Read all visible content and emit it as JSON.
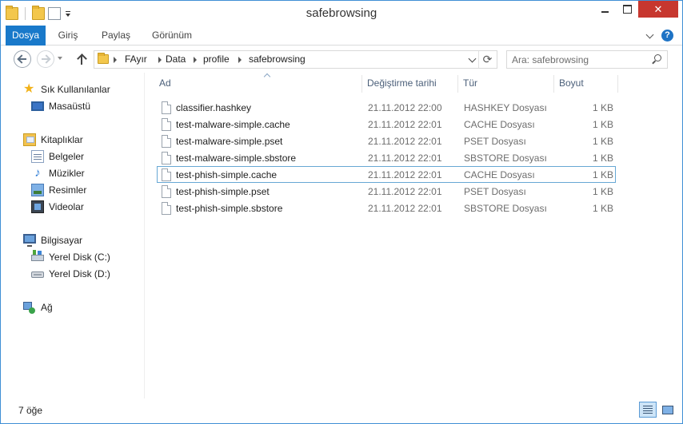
{
  "window": {
    "title": "safebrowsing"
  },
  "ribbon": {
    "tabs": [
      {
        "label": "Dosya"
      },
      {
        "label": "Giriş"
      },
      {
        "label": "Paylaş"
      },
      {
        "label": "Görünüm"
      }
    ],
    "help_label": "?"
  },
  "navigation": {
    "breadcrumb": [
      "FAyır",
      "Data",
      "profile",
      "safebrowsing"
    ],
    "refresh_glyph": "⟳",
    "search_placeholder": "Ara: safebrowsing"
  },
  "sidebar": {
    "favorites": {
      "label": "Sık Kullanılanlar",
      "icon": "star-icon"
    },
    "favorites_items": [
      {
        "label": "Masaüstü",
        "icon": "desktop-icon"
      }
    ],
    "libraries": {
      "label": "Kitaplıklar",
      "icon": "library-icon"
    },
    "libraries_items": [
      {
        "label": "Belgeler",
        "icon": "documents-icon"
      },
      {
        "label": "Müzikler",
        "icon": "music-icon"
      },
      {
        "label": "Resimler",
        "icon": "pictures-icon"
      },
      {
        "label": "Videolar",
        "icon": "videos-icon"
      }
    ],
    "computer": {
      "label": "Bilgisayar",
      "icon": "computer-icon"
    },
    "computer_items": [
      {
        "label": "Yerel Disk (C:)",
        "icon": "disk-icon"
      },
      {
        "label": "Yerel Disk (D:)",
        "icon": "disk-icon"
      }
    ],
    "network": {
      "label": "Ağ",
      "icon": "network-icon"
    }
  },
  "file_list": {
    "columns": [
      "Ad",
      "Değiştirme tarihi",
      "Tür",
      "Boyut"
    ],
    "rows": [
      {
        "name": "classifier.hashkey",
        "date": "21.11.2012 22:00",
        "type": "HASHKEY Dosyası",
        "size": "1 KB"
      },
      {
        "name": "test-malware-simple.cache",
        "date": "21.11.2012 22:01",
        "type": "CACHE Dosyası",
        "size": "1 KB"
      },
      {
        "name": "test-malware-simple.pset",
        "date": "21.11.2012 22:01",
        "type": "PSET Dosyası",
        "size": "1 KB"
      },
      {
        "name": "test-malware-simple.sbstore",
        "date": "21.11.2012 22:01",
        "type": "SBSTORE Dosyası",
        "size": "1 KB"
      },
      {
        "name": "test-phish-simple.cache",
        "date": "21.11.2012 22:01",
        "type": "CACHE Dosyası",
        "size": "1 KB"
      },
      {
        "name": "test-phish-simple.pset",
        "date": "21.11.2012 22:01",
        "type": "PSET Dosyası",
        "size": "1 KB"
      },
      {
        "name": "test-phish-simple.sbstore",
        "date": "21.11.2012 22:01",
        "type": "SBSTORE Dosyası",
        "size": "1 KB"
      }
    ],
    "focused_row": 4
  },
  "status": {
    "item_count": "7 öğe"
  },
  "colors": {
    "accent": "#1979ca",
    "close": "#c7372f",
    "focus_border": "#67a8d4"
  }
}
